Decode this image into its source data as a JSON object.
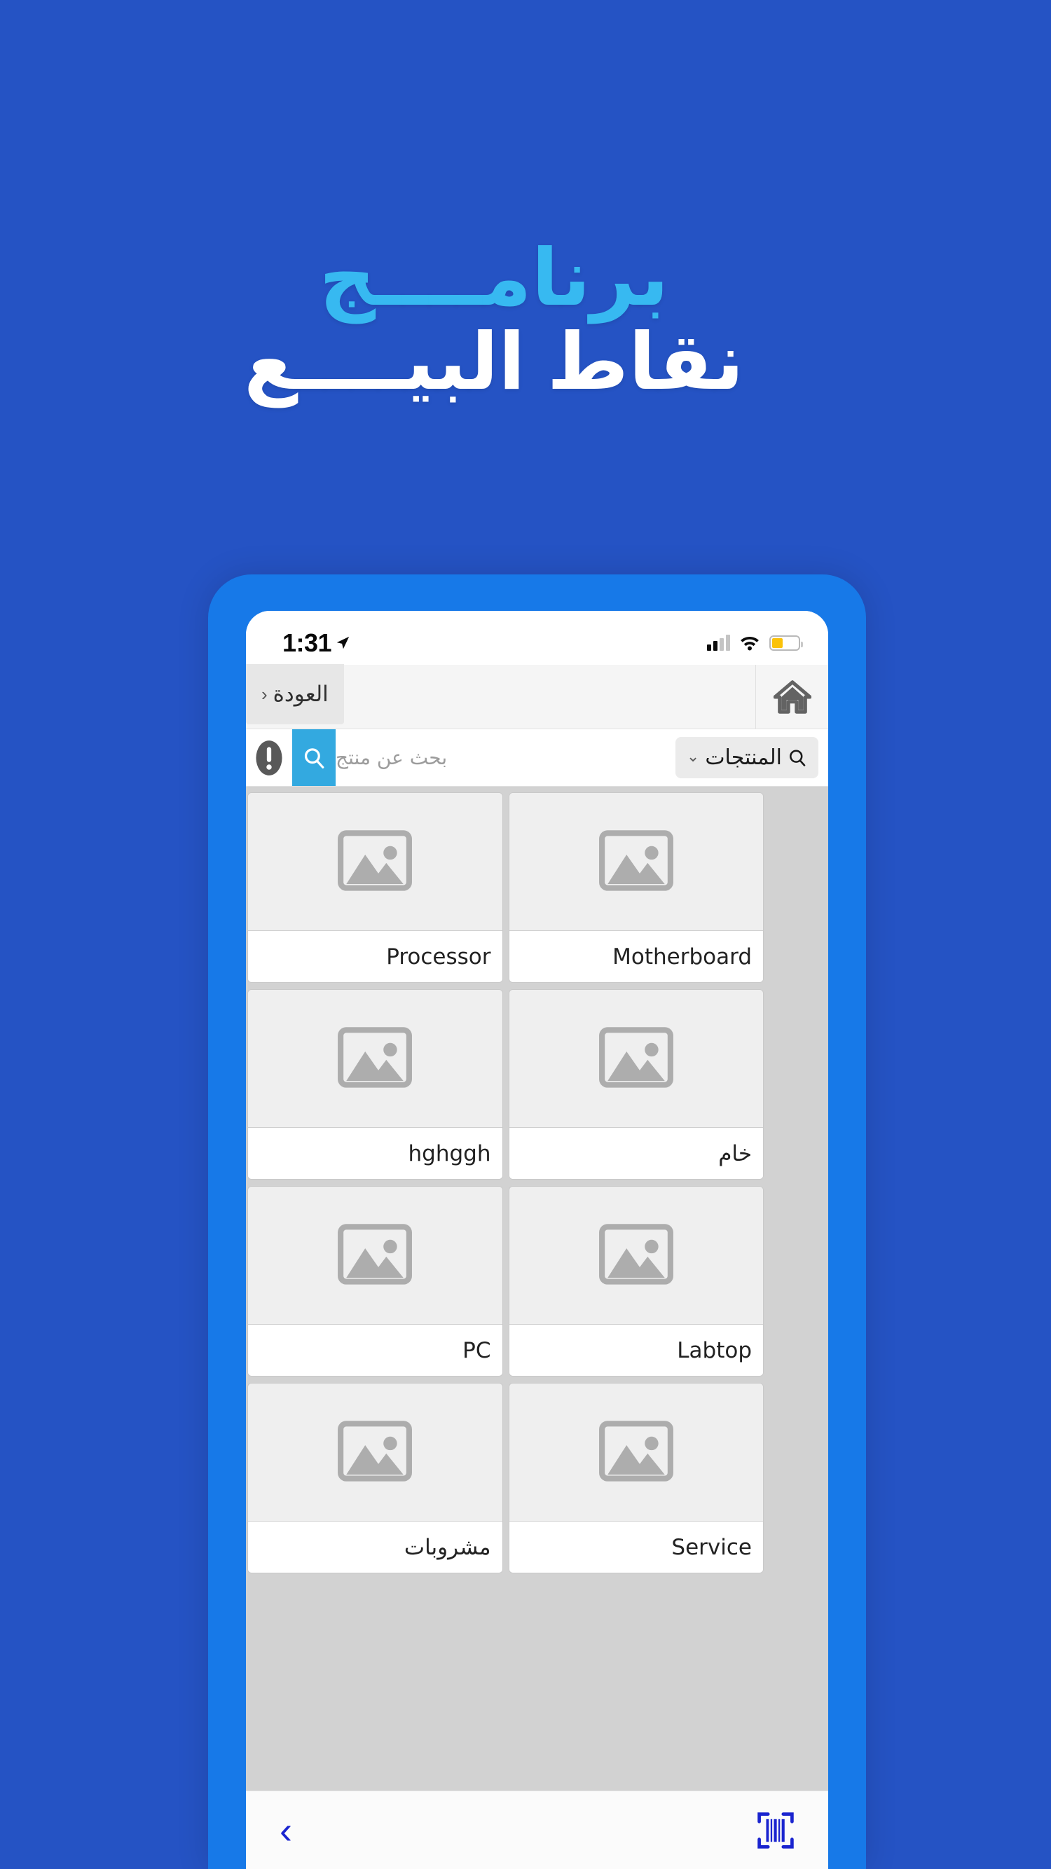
{
  "hero": {
    "line1": "برنامــــج",
    "line2": "نقاط البيــــع",
    "line1_color": "#37b9f1",
    "line2_color": "#ffffff",
    "background_color": "#2553c4"
  },
  "phone": {
    "frame_color": "#1779e8",
    "status_bar": {
      "time": "1:31",
      "location_icon": "location-arrow-icon",
      "signal_icon": "cellular-signal-icon",
      "signal_bars_filled": 2,
      "signal_bars_total": 4,
      "wifi_icon": "wifi-icon",
      "battery_icon": "battery-icon",
      "battery_percent": 42,
      "battery_color": "#fbc209"
    }
  },
  "navbar": {
    "back_label": "العودة",
    "back_chevron": "‹",
    "home_icon": "home-icon"
  },
  "searchbar": {
    "warning_icon": "exclamation-icon",
    "search_icon": "search-icon",
    "search_button_color": "#33a9e0",
    "placeholder": "بحث عن منتج",
    "value": "",
    "category": {
      "label": "المنتجات",
      "icon": "search-icon",
      "chevron": "⌄"
    }
  },
  "products": [
    {
      "name": "Motherboard",
      "image": "image-placeholder-icon"
    },
    {
      "name": "Processor",
      "image": "image-placeholder-icon"
    },
    {
      "name": "خام",
      "image": "image-placeholder-icon"
    },
    {
      "name": "hghggh",
      "image": "image-placeholder-icon"
    },
    {
      "name": "Labtop",
      "image": "image-placeholder-icon"
    },
    {
      "name": "PC",
      "image": "image-placeholder-icon"
    },
    {
      "name": "Service",
      "image": "image-placeholder-icon"
    },
    {
      "name": "مشروبات",
      "image": "image-placeholder-icon"
    }
  ],
  "bottombar": {
    "back_chevron": "‹",
    "barcode_icon": "barcode-scanner-icon",
    "accent_color": "#1a24cf"
  }
}
